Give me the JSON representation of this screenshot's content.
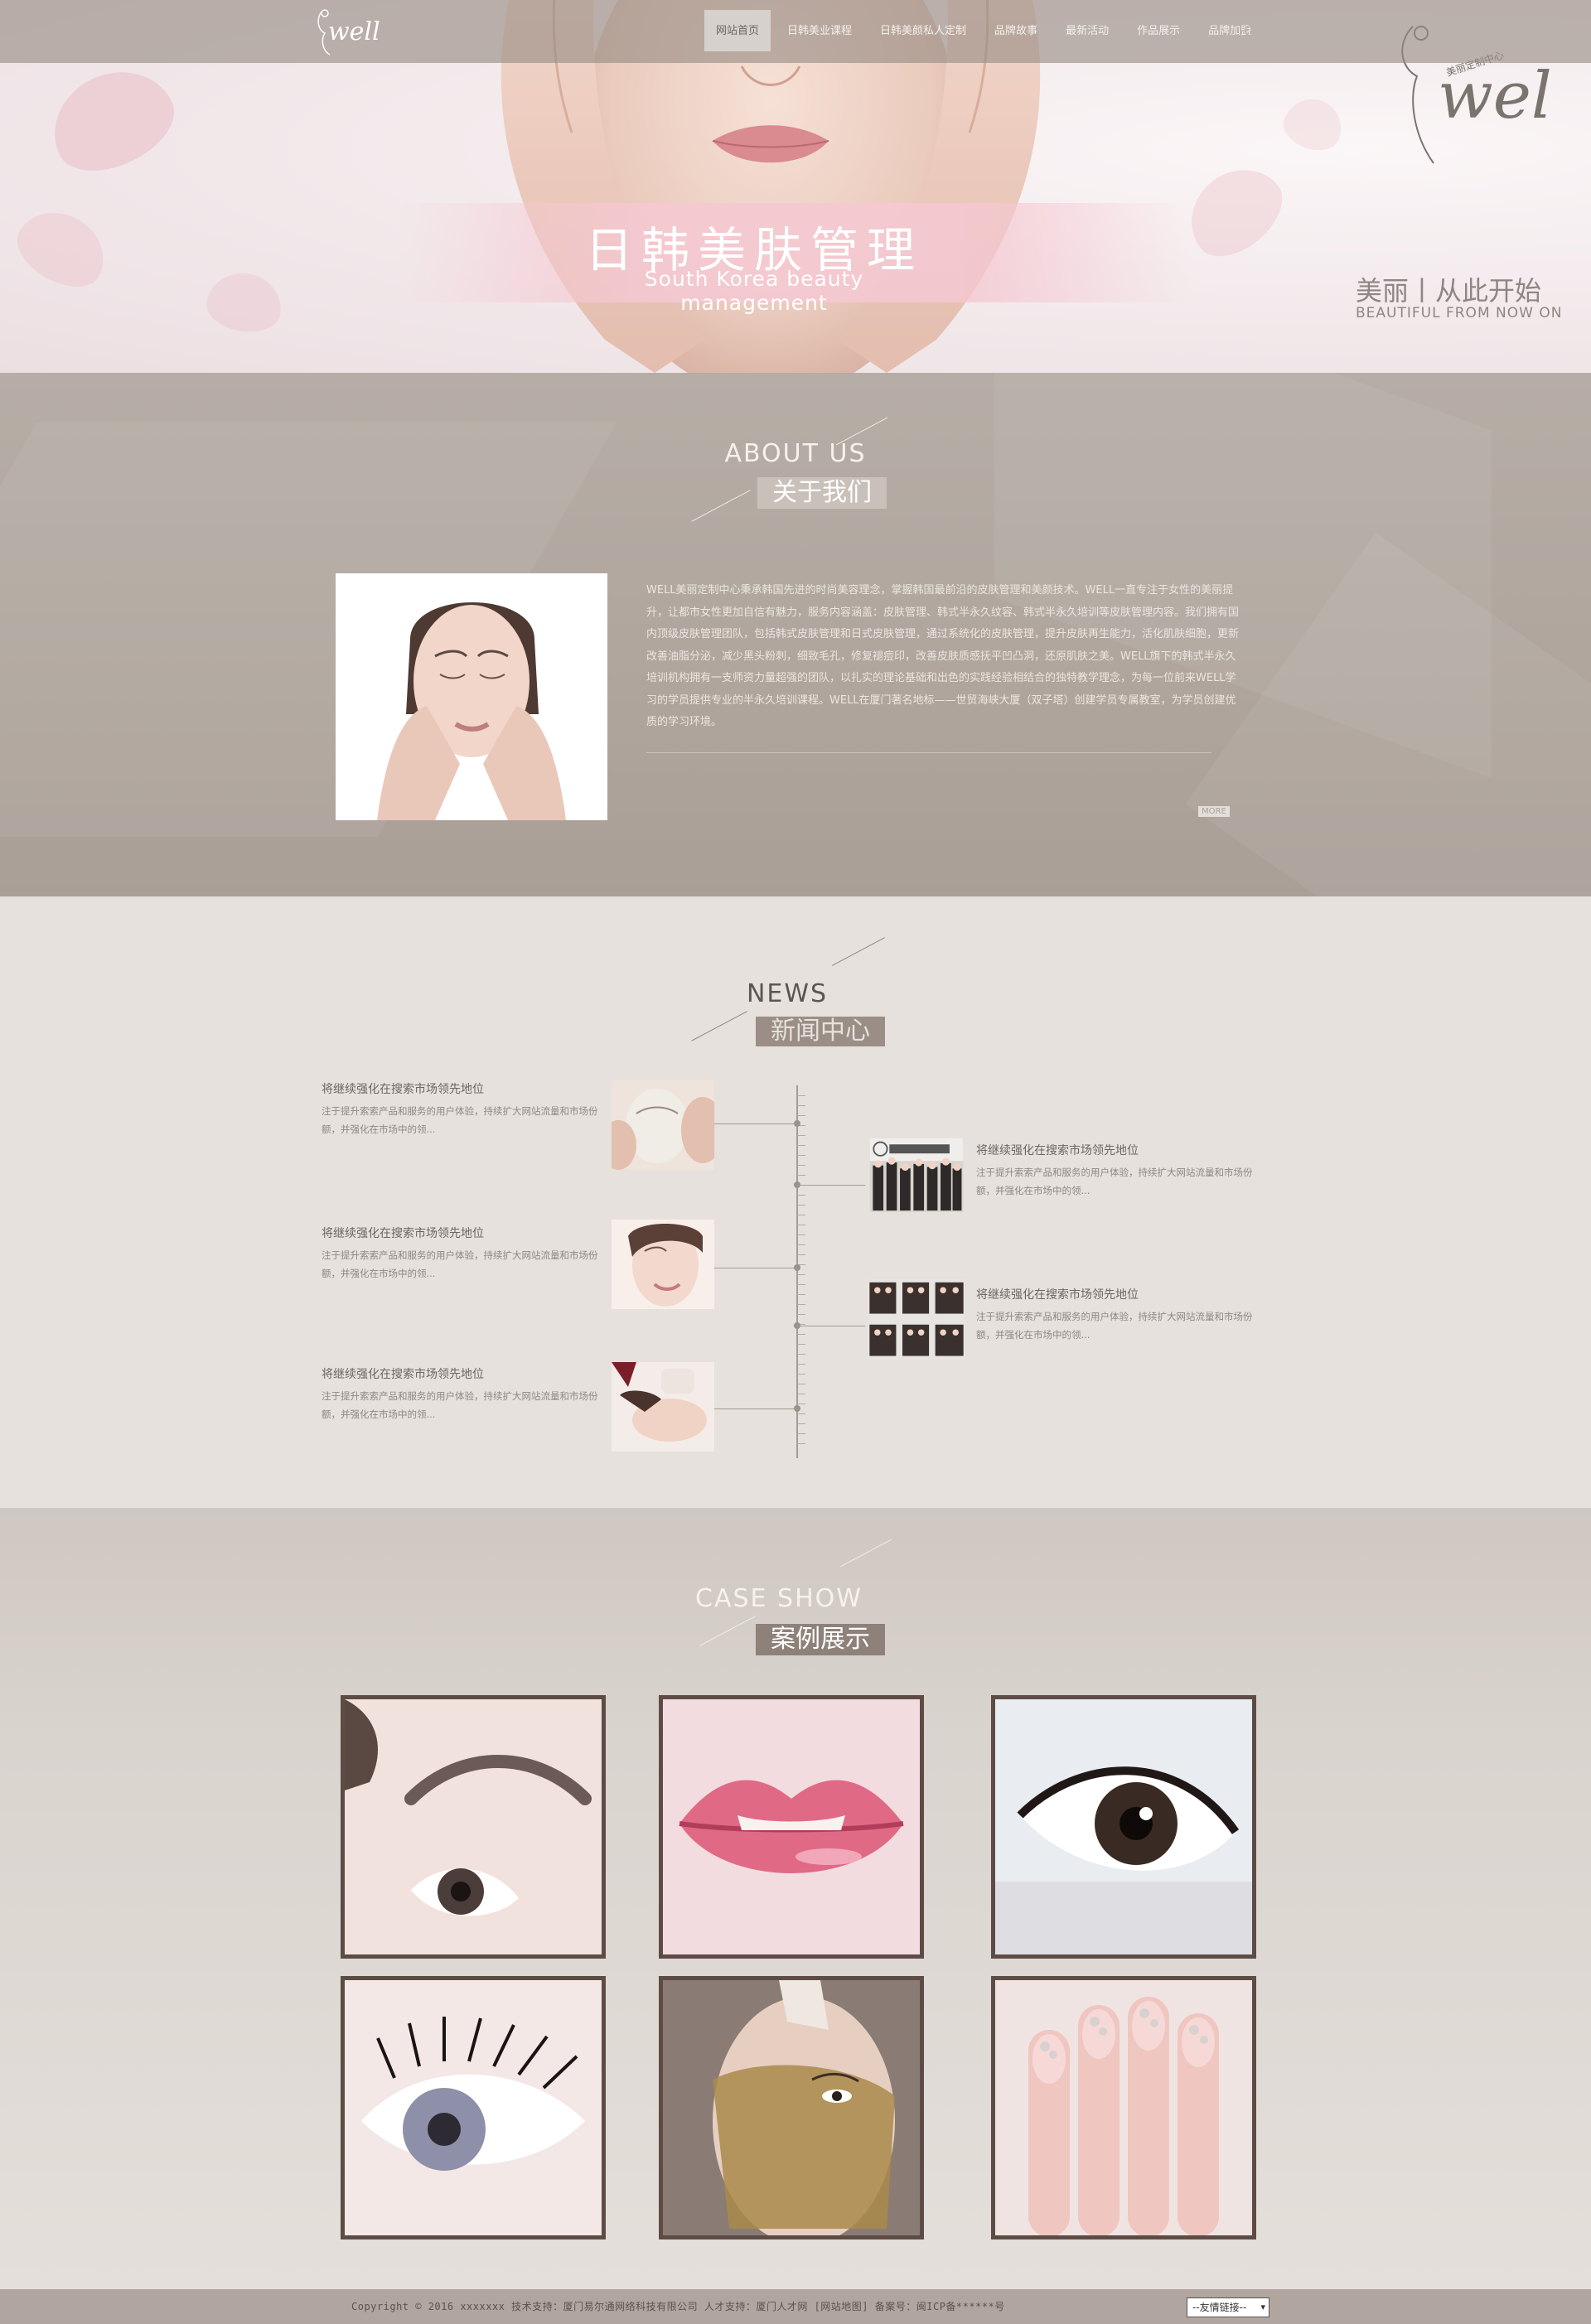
{
  "nav": {
    "logo_text": "well",
    "items": [
      {
        "label": "网站首页",
        "active": true
      },
      {
        "label": "日韩美业课程",
        "active": false
      },
      {
        "label": "日韩美颜私人定制",
        "active": false
      },
      {
        "label": "品牌故事",
        "active": false
      },
      {
        "label": "最新活动",
        "active": false
      },
      {
        "label": "作品展示",
        "active": false
      },
      {
        "label": "品牌加盟",
        "active": false
      }
    ],
    "search_icon": "search-icon"
  },
  "banner": {
    "title_cn": "日韩美肤管理",
    "title_en": "South Korea beauty management",
    "slogan": "美丽丨从此开始",
    "slogan_en": "BEAUTIFUL FROM NOW ON",
    "brand_text": "well",
    "brand_sub": "美丽定制中心"
  },
  "about": {
    "heading_en": "ABOUT US",
    "heading_cn": "关于我们",
    "body": "WELL美丽定制中心秉承韩国先进的时尚美容理念，掌握韩国最前沿的皮肤管理和美颜技术。WELL一直专注于女性的美丽提升，让都市女性更加自信有魅力，服务内容涵盖：皮肤管理、韩式半永久纹容、韩式半永久培训等皮肤管理内容。我们拥有国内顶级皮肤管理团队，包括韩式皮肤管理和日式皮肤管理，通过系统化的皮肤管理，提升皮肤再生能力，活化肌肤细胞，更新改善油脂分泌，减少黑头粉刺，细致毛孔，修复褪痘印，改善皮肤质感抚平凹凸洞，还原肌肤之美。WELL旗下的韩式半永久培训机构拥有一支师资力量超强的团队，以扎实的理论基础和出色的实践经验相结合的独特教学理念，为每一位前来WELL学习的学员提供专业的半永久培训课程。WELL在厦门著名地标——世贸海峡大厦（双子塔）创建学员专属教室，为学员创建优质的学习环境。",
    "more": "MORE"
  },
  "news": {
    "heading_en": "NEWS",
    "heading_cn": "新闻中心",
    "items": [
      {
        "title": "将继续强化在搜索市场领先地位",
        "desc": "注于提升索索产品和服务的用户体验，持续扩大网站流量和市场份额，并强化在市场中的领..."
      },
      {
        "title": "将继续强化在搜索市场领先地位",
        "desc": "注于提升索索产品和服务的用户体验，持续扩大网站流量和市场份额，并强化在市场中的领..."
      },
      {
        "title": "将继续强化在搜索市场领先地位",
        "desc": "注于提升索索产品和服务的用户体验，持续扩大网站流量和市场份额，并强化在市场中的领..."
      },
      {
        "title": "将继续强化在搜索市场领先地位",
        "desc": "注于提升索索产品和服务的用户体验，持续扩大网站流量和市场份额，并强化在市场中的领..."
      },
      {
        "title": "将继续强化在搜索市场领先地位",
        "desc": "注于提升索索产品和服务的用户体验，持续扩大网站流量和市场份额，并强化在市场中的领..."
      }
    ]
  },
  "cases": {
    "heading_en": "CASE SHOW",
    "heading_cn": "案例展示",
    "items": [
      "eyebrow",
      "lips",
      "eye-makeup",
      "eyelashes",
      "gold-mask",
      "nails"
    ]
  },
  "footer": {
    "copyright": "Copyright © 2016 xxxxxxx 技术支持：厦门易尔通网络科技有限公司 人才支持：厦门人才网 [网站地图] 备案号：闽ICP备******号",
    "select_label": "--友情链接--"
  }
}
